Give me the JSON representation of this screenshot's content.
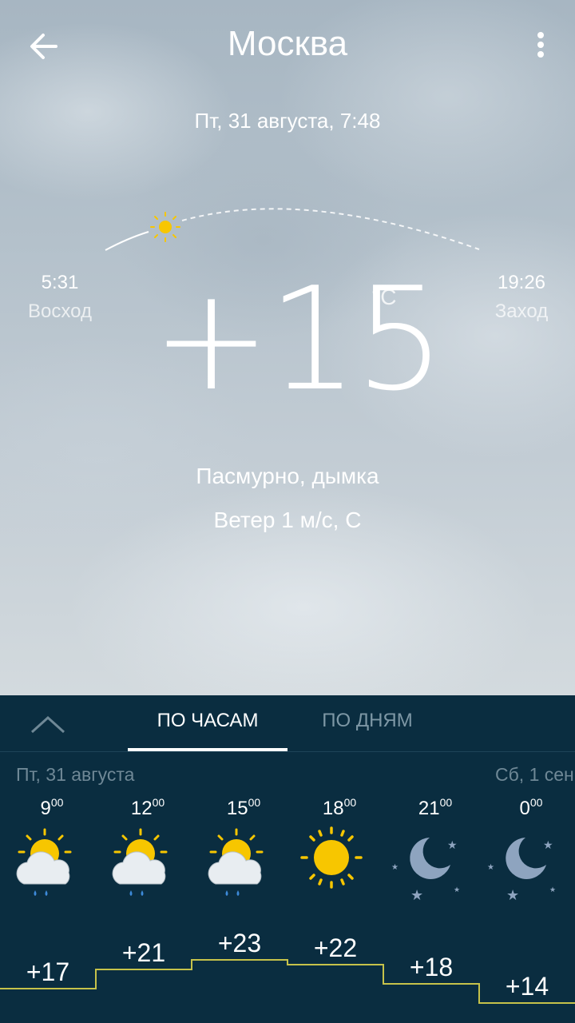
{
  "header": {
    "city": "Москва",
    "datetime": "Пт, 31 августа, 7:48"
  },
  "sun": {
    "sunrise_time": "5:31",
    "sunrise_label": "Восход",
    "sunset_time": "19:26",
    "sunset_label": "Заход"
  },
  "current": {
    "temperature": "+15",
    "unit": "°C",
    "condition": "Пасмурно, дымка",
    "wind": "Ветер 1 м/с, С"
  },
  "tabs": {
    "hourly": "ПО ЧАСАМ",
    "daily": "ПО ДНЯМ"
  },
  "days": {
    "left": "Пт, 31 августа",
    "right": "Сб, 1 сен"
  },
  "hourly": [
    {
      "hour": "9",
      "min": "00",
      "icon": "sun-cloud-rain-icon",
      "temp": "+17"
    },
    {
      "hour": "12",
      "min": "00",
      "icon": "sun-cloud-rain-icon",
      "temp": "+21"
    },
    {
      "hour": "15",
      "min": "00",
      "icon": "sun-cloud-rain-icon",
      "temp": "+23"
    },
    {
      "hour": "18",
      "min": "00",
      "icon": "sun-icon",
      "temp": "+22"
    },
    {
      "hour": "21",
      "min": "00",
      "icon": "moon-stars-icon",
      "temp": "+18"
    },
    {
      "hour": "0",
      "min": "00",
      "icon": "moon-stars-icon",
      "temp": "+14"
    }
  ],
  "colors": {
    "panel": "#0a2d40",
    "graph_line": "#c6c24a",
    "sun": "#f7c600",
    "moon": "#8ea4bf"
  }
}
